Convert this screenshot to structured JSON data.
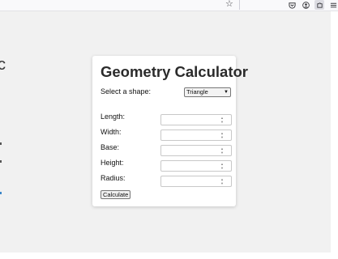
{
  "browser_toolbar": {
    "star_glyph": "☆",
    "pocket_icon": "pocket-icon",
    "account_icon": "account-icon",
    "extensions_icon": "extensions-icon",
    "menu_icon": "hamburger-menu-icon"
  },
  "background_page": {
    "partial_letter": "c"
  },
  "calculator": {
    "title": "Geometry Calculator",
    "shape_label": "Select a shape:",
    "shape_selected": "Triangle",
    "fields": [
      {
        "label": "Length:",
        "value": ""
      },
      {
        "label": "Width:",
        "value": ""
      },
      {
        "label": "Base:",
        "value": ""
      },
      {
        "label": "Height:",
        "value": ""
      },
      {
        "label": "Radius:",
        "value": ""
      }
    ],
    "calculate_label": "Calculate"
  }
}
